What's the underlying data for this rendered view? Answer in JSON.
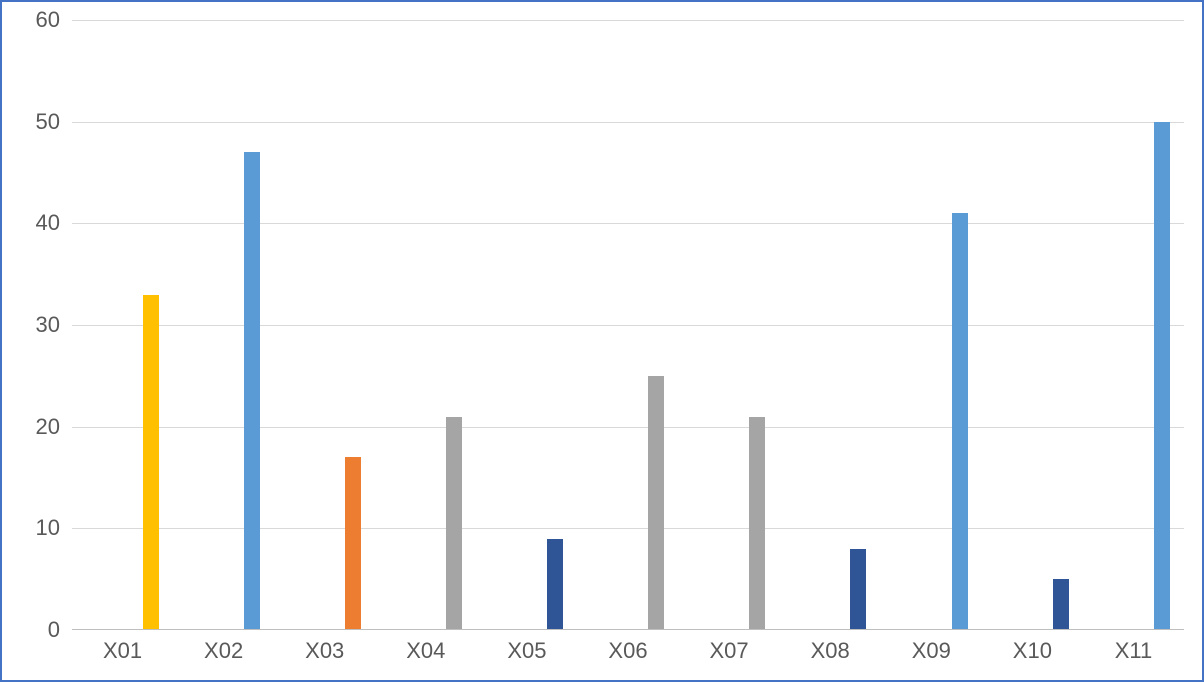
{
  "chart_data": {
    "type": "bar",
    "title": "",
    "xlabel": "",
    "ylabel": "",
    "ylim": [
      0,
      60
    ],
    "y_ticks": [
      0,
      10,
      20,
      30,
      40,
      50,
      60
    ],
    "categories": [
      "X01",
      "X02",
      "X03",
      "X04",
      "X05",
      "X06",
      "X07",
      "X08",
      "X09",
      "X10",
      "X11"
    ],
    "values": [
      33,
      47,
      17,
      21,
      9,
      25,
      21,
      8,
      41,
      5,
      50
    ],
    "bar_colors": [
      "#ffc000",
      "#5b9bd5",
      "#ed7d31",
      "#a5a5a5",
      "#2f5597",
      "#a5a5a5",
      "#a5a5a5",
      "#2f5597",
      "#5b9bd5",
      "#2f5597",
      "#5b9bd5"
    ],
    "legend": null,
    "grid": true
  }
}
